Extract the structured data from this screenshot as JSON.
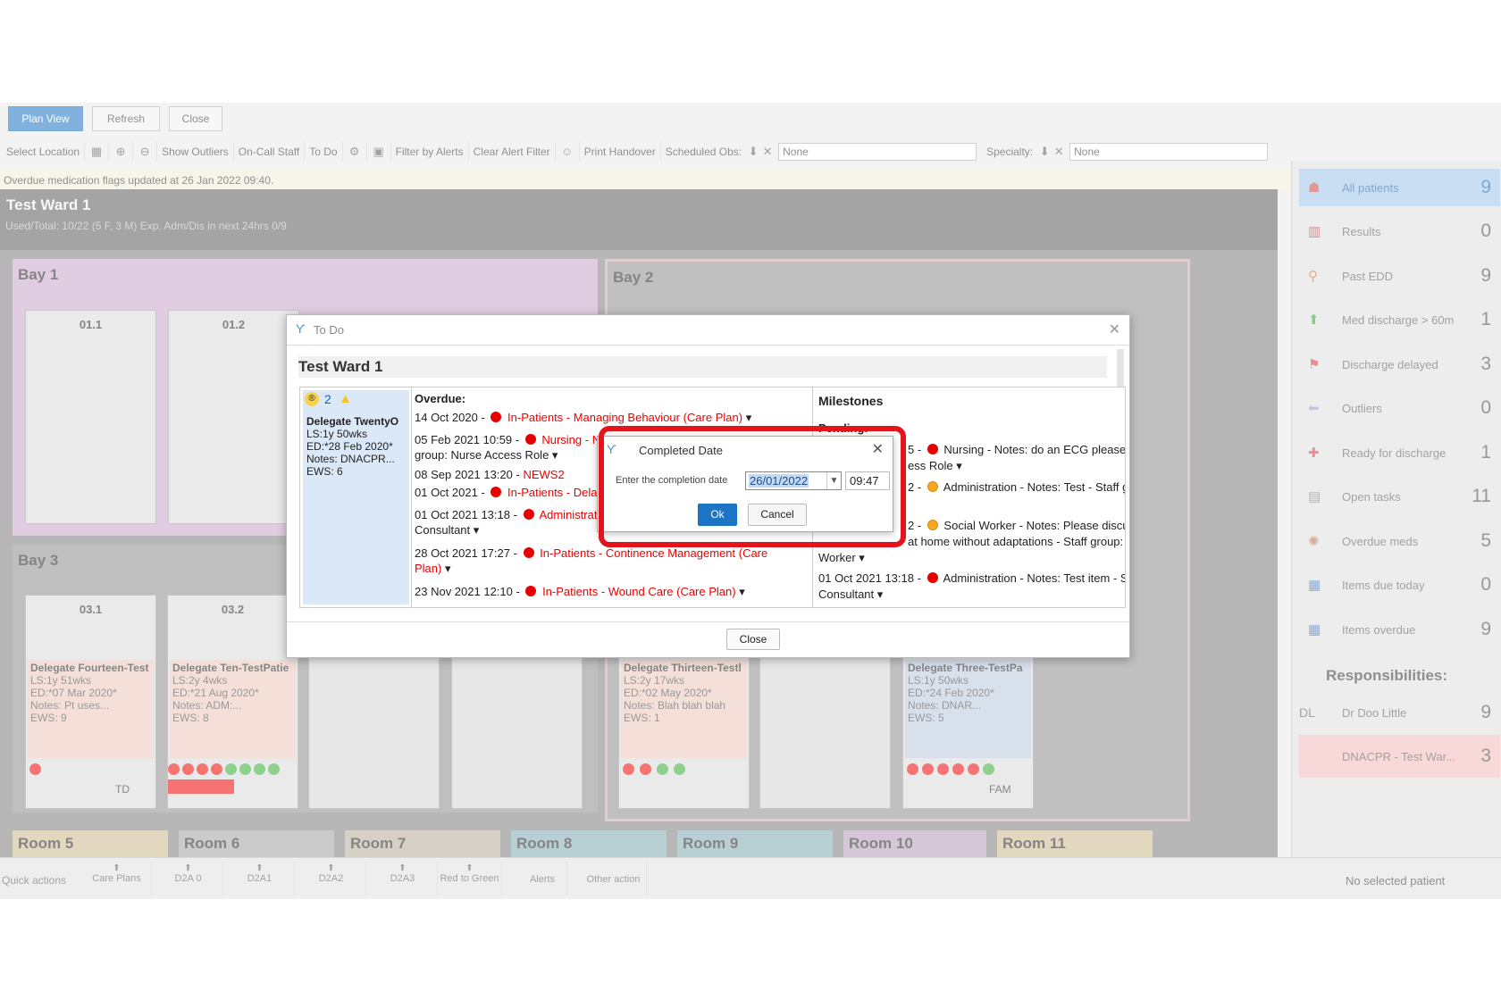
{
  "toolbar": {
    "plan_view": "Plan View",
    "refresh": "Refresh",
    "close": "Close"
  },
  "toolbar2": {
    "select_location": "Select Location",
    "show_outliers": "Show Outliers",
    "on_call_staff": "On-Call Staff",
    "to_do": "To Do",
    "filter_by_alerts": "Filter by Alerts",
    "clear_alert_filter": "Clear Alert Filter",
    "print_handover": "Print Handover",
    "scheduled_obs_label": "Scheduled Obs:",
    "scheduled_obs_value": "None",
    "specialty_label": "Specialty:",
    "specialty_value": "None"
  },
  "notice": "Overdue medication flags updated at 26 Jan 2022 09:40.",
  "ward": {
    "title": "Test Ward 1",
    "subtitle": "Used/Total: 10/22 (5 F, 3 M) Exp. Adm/Dis in next 24hrs 0/9"
  },
  "bays": [
    {
      "title": "Bay 1",
      "color": "#c9a4c9"
    },
    {
      "title": "Bay 2",
      "color": "#8a8a8a"
    },
    {
      "title": "Bay 3",
      "color": "#8a8a8a"
    }
  ],
  "beds": {
    "b011": "01.1",
    "b012": "01.2",
    "b031": "03.1",
    "b032": "03.2"
  },
  "patients": [
    {
      "name": "Delegate Fourteen-Test",
      "ls": "LS:1y 51wks",
      "ed": "ED:*07 Mar 2020*",
      "notes": "Notes: Pt uses...",
      "ews": "EWS: 9",
      "tag": "TD"
    },
    {
      "name": "Delegate Ten-TestPatie",
      "ls": "LS:2y 4wks",
      "ed": "ED:*21 Aug 2020*",
      "notes": "Notes: ADM:...",
      "ews": "EWS: 8"
    },
    {
      "name": "Delegate Thirteen-Testl",
      "ls": "LS:2y 17wks",
      "ed": "ED:*02 May 2020*",
      "notes": "Notes: Blah blah blah",
      "ews": "EWS: 1"
    },
    {
      "name": "Delegate Three-TestPa",
      "ls": "LS:1y 50wks",
      "ed": "ED:*24 Feb 2020*",
      "notes": "Notes: DNAR...",
      "ews": "EWS: 5",
      "tag": "FAM"
    }
  ],
  "rooms": [
    {
      "label": "Room 5",
      "color": "#c8b98a"
    },
    {
      "label": "Room 6",
      "color": "#a0a0a0"
    },
    {
      "label": "Room 7",
      "color": "#b5a99a"
    },
    {
      "label": "Room 8",
      "color": "#7fa8b0"
    },
    {
      "label": "Room 9",
      "color": "#7fa8b0"
    },
    {
      "label": "Room 10",
      "color": "#b49ab8"
    },
    {
      "label": "Room 11",
      "color": "#c8b98a"
    }
  ],
  "right_panel": {
    "items": [
      {
        "label": "All patients",
        "count": "9",
        "icon": "users-icon"
      },
      {
        "label": "Results",
        "count": "0",
        "icon": "results-icon"
      },
      {
        "label": "Past EDD",
        "count": "9",
        "icon": "past-edd-icon"
      },
      {
        "label": "Med discharge > 60m",
        "count": "1",
        "icon": "arrow-up-icon"
      },
      {
        "label": "Discharge delayed",
        "count": "3",
        "icon": "discharge-delayed-icon"
      },
      {
        "label": "Outliers",
        "count": "0",
        "icon": "arrow-left-icon"
      },
      {
        "label": "Ready for discharge",
        "count": "1",
        "icon": "ready-discharge-icon"
      },
      {
        "label": "Open tasks",
        "count": "11",
        "icon": "tasks-icon"
      },
      {
        "label": "Overdue meds",
        "count": "5",
        "icon": "meds-icon"
      },
      {
        "label": "Items due today",
        "count": "0",
        "icon": "calendar-icon"
      },
      {
        "label": "Items overdue",
        "count": "9",
        "icon": "calendar-overdue-icon"
      }
    ],
    "responsibilities_title": "Responsibilities:",
    "resp_initials": "DL",
    "resp_name": "Dr Doo Little",
    "resp_count": "9",
    "dnacpr_label": "DNACPR - Test War...",
    "dnacpr_count": "3"
  },
  "quick_actions": {
    "label": "Quick actions",
    "buttons": [
      "Care Plans",
      "D2A 0",
      "D2A1",
      "D2A2",
      "D2A3",
      "Red to Green",
      "Alerts",
      "Other action"
    ],
    "no_selected": "No selected patient"
  },
  "todo": {
    "title": "To Do",
    "ward": "Test Ward 1",
    "count": "2",
    "patient": {
      "name": "Delegate TwentyO",
      "ls": "LS:1y 50wks",
      "ed": "ED:*28 Feb 2020*",
      "notes": "Notes: DNACPR...",
      "ews": "EWS: 6"
    },
    "overdue_title": "Overdue:",
    "overdue": [
      {
        "date": "14 Oct 2020 -",
        "text": "In-Patients - Managing Behaviour (Care Plan)"
      },
      {
        "date": "05 Feb 2021 10:59 -",
        "text": "Nursing - Not",
        "sub": "group: Nurse Access Role"
      },
      {
        "date": "08 Sep 2021 13:20 -",
        "text": "NEWS2"
      },
      {
        "date": "01 Oct 2021 -",
        "text": "In-Patients - Dela"
      },
      {
        "date": "01 Oct 2021 13:18 -",
        "text": "Administratio",
        "sub": "Consultant"
      },
      {
        "date": "28 Oct 2021 17:27 -",
        "text": "In-Patients - Continence Management (Care",
        "sub": "Plan)"
      },
      {
        "date": "23 Nov 2021 12:10 -",
        "text": "In-Patients - Wound Care (Care Plan)"
      }
    ],
    "milestones_title": "Milestones",
    "pending": "Pending:",
    "milestones": [
      {
        "prefix": "5 -",
        "text": "Nursing - Notes: do an ECG please - Staff",
        "sub": "ess Role"
      },
      {
        "prefix": "2 -",
        "text": "Administration - Notes: Test - Staff group:"
      },
      {
        "prefix": "2 -",
        "text": "Social Worker - Notes: Please discuss how",
        "sub": "at home without adaptations - Staff group: Social",
        "sub2": "Worker"
      },
      {
        "prefix": "01 Oct 2021 13:18 -",
        "text": "Administration - Notes: Test item - Staff group:",
        "sub": "Consultant"
      }
    ],
    "close": "Close"
  },
  "completed_date": {
    "title": "Completed Date",
    "label": "Enter the completion date",
    "date": "26/01/2022",
    "time": "09:47",
    "ok": "Ok",
    "cancel": "Cancel"
  }
}
